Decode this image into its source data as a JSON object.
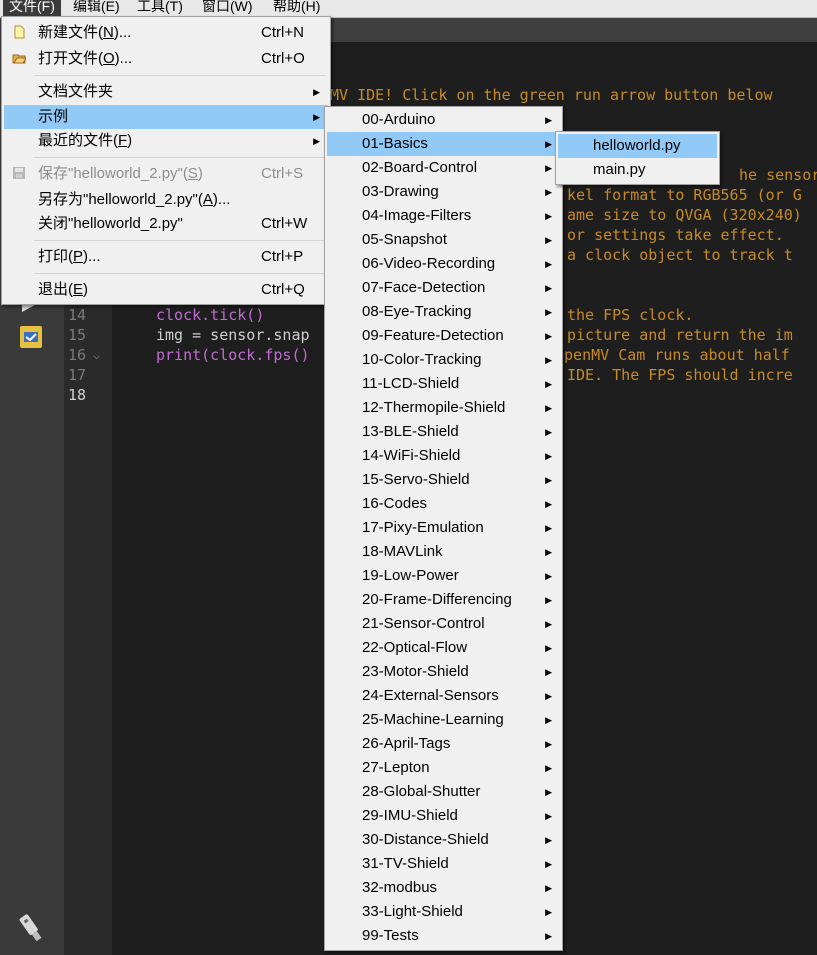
{
  "menubar": {
    "items": [
      "文件(F)",
      "编辑(E)",
      "工具(T)",
      "窗口(W)",
      "帮助(H)"
    ],
    "active_index": 0
  },
  "editor": {
    "lines": [
      {
        "num": "14",
        "code": "clock.tick()",
        "comment": "the FPS clock."
      },
      {
        "num": "15",
        "code": "img = sensor.snap",
        "comment": "picture and return the im"
      },
      {
        "num": "16",
        "code": "print(clock.fps()",
        "comment": "OpenMV Cam runs about half"
      },
      {
        "num": "17",
        "code": "",
        "comment": "IDE. The FPS should incre"
      },
      {
        "num": "18",
        "code": "",
        "comment": ""
      }
    ],
    "header_comments": [
      "MV IDE! Click on the green run arrow button below",
      "he sensor.",
      "kel format to RGB565 (or G",
      "ame size to QVGA (320x240)",
      "or settings take effect.",
      "a clock object to track t"
    ]
  },
  "file_menu": {
    "items": [
      {
        "label": "新建文件(",
        "key": "N",
        "tail": ")...",
        "shortcut": "Ctrl+N",
        "icon": "new-file-icon"
      },
      {
        "label": "打开文件(",
        "key": "O",
        "tail": ")...",
        "shortcut": "Ctrl+O",
        "icon": "open-folder-icon"
      },
      {
        "label": "文档文件夹",
        "key": "",
        "tail": "",
        "shortcut": "",
        "submenu": true
      },
      {
        "label": "示例",
        "key": "",
        "tail": "",
        "shortcut": "",
        "submenu": true,
        "highlighted": true
      },
      {
        "label": "最近的文件(",
        "key": "F",
        "tail": ")",
        "shortcut": "",
        "submenu": true
      },
      {
        "label": "保存\"helloworld_2.py\"(",
        "key": "S",
        "tail": ")",
        "shortcut": "Ctrl+S",
        "disabled": true,
        "icon": "save-icon"
      },
      {
        "label": "另存为\"helloworld_2.py\"(",
        "key": "A",
        "tail": ")...",
        "shortcut": ""
      },
      {
        "label": "关闭\"helloworld_2.py\"",
        "key": "",
        "tail": "",
        "shortcut": "Ctrl+W"
      },
      {
        "label": "打印(",
        "key": "P",
        "tail": ")...",
        "shortcut": "Ctrl+P"
      },
      {
        "label": "退出(",
        "key": "E",
        "tail": ")",
        "shortcut": "Ctrl+Q"
      }
    ]
  },
  "examples_menu": {
    "items": [
      "00-Arduino",
      "01-Basics",
      "02-Board-Control",
      "03-Drawing",
      "04-Image-Filters",
      "05-Snapshot",
      "06-Video-Recording",
      "07-Face-Detection",
      "08-Eye-Tracking",
      "09-Feature-Detection",
      "10-Color-Tracking",
      "11-LCD-Shield",
      "12-Thermopile-Shield",
      "13-BLE-Shield",
      "14-WiFi-Shield",
      "15-Servo-Shield",
      "16-Codes",
      "17-Pixy-Emulation",
      "18-MAVLink",
      "19-Low-Power",
      "20-Frame-Differencing",
      "21-Sensor-Control",
      "22-Optical-Flow",
      "23-Motor-Shield",
      "24-External-Sensors",
      "25-Machine-Learning",
      "26-April-Tags",
      "27-Lepton",
      "28-Global-Shutter",
      "29-IMU-Shield",
      "30-Distance-Shield",
      "31-TV-Shield",
      "32-modbus",
      "33-Light-Shield",
      "99-Tests"
    ],
    "highlighted_index": 1
  },
  "basics_menu": {
    "items": [
      "helloworld.py",
      "main.py"
    ],
    "highlighted_index": 0
  },
  "colors": {
    "highlight": "#91c9f7",
    "comment": "#c88a24",
    "editor_bg": "#1e1e1e"
  }
}
